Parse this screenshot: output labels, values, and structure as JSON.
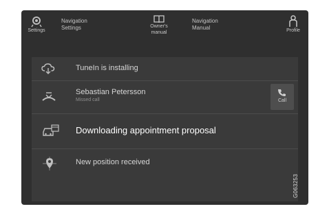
{
  "topbar": {
    "settings_label": "Settings",
    "nav_settings_line1": "Navigation",
    "nav_settings_line2": "Settings",
    "owners_manual_line1": "Owner's",
    "owners_manual_line2": "manual",
    "nav_manual_line1": "Navigation",
    "nav_manual_line2": "Manual",
    "profile_label": "Profile"
  },
  "notifications": [
    {
      "icon": "cloud-download-icon",
      "title": "TuneIn is installing"
    },
    {
      "icon": "missed-call-icon",
      "title": "Sebastian Petersson",
      "subtitle": "Missed call",
      "action_label": "Call"
    },
    {
      "icon": "car-calendar-icon",
      "title": "Downloading appointment proposal"
    },
    {
      "icon": "map-pin-icon",
      "title": "New position received"
    }
  ],
  "watermark": "G063253",
  "colors": {
    "screen_bg": "#2f2f2f",
    "panel_bg": "#3a3a3a",
    "text": "#d6d6d6",
    "highlight_text": "#ffffff"
  }
}
